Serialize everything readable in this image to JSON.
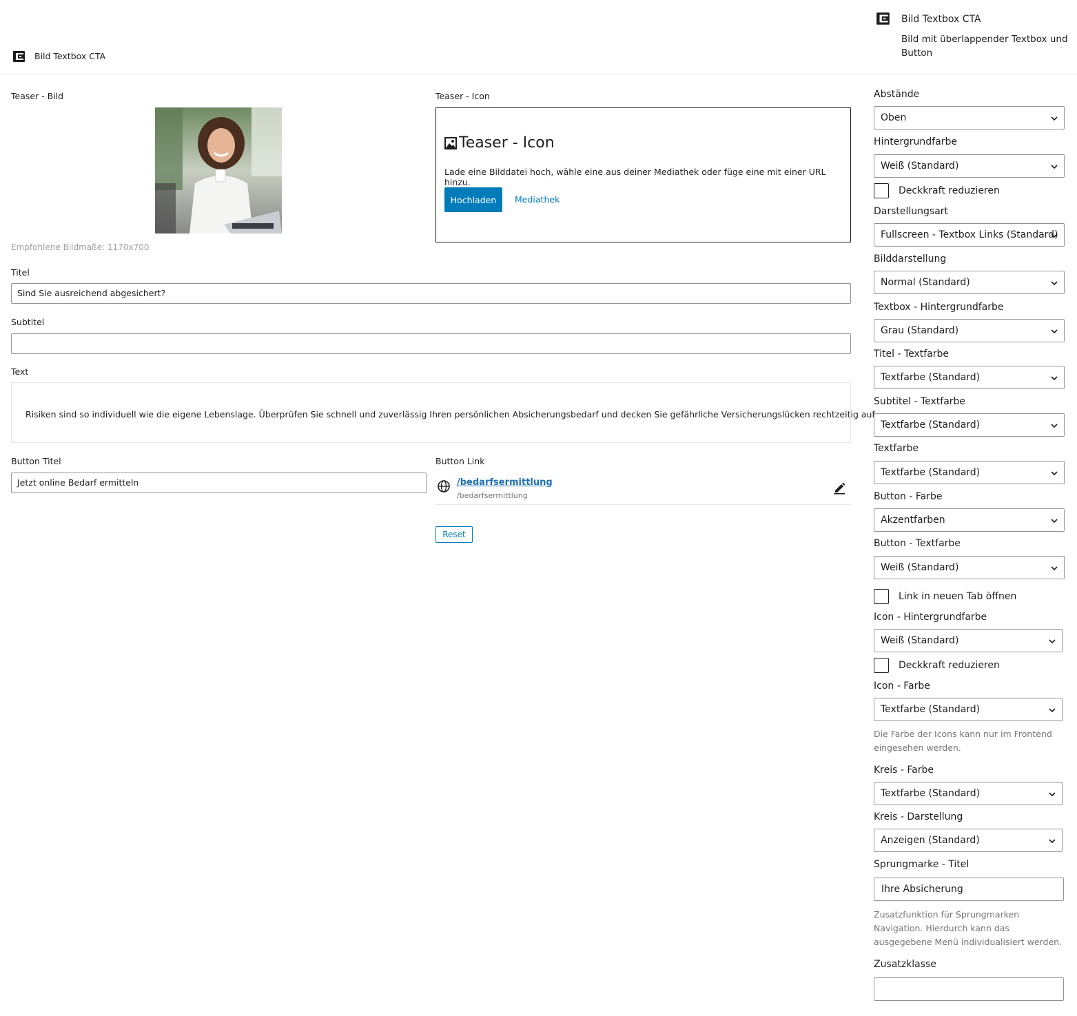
{
  "block": {
    "title": "Bild Textbox CTA",
    "description": "Bild mit überlappender Textbox und Button"
  },
  "teaser_image": {
    "label": "Teaser - Bild",
    "hint": "Empfohlene Bildmaße: 1170x700"
  },
  "teaser_icon": {
    "label": "Teaser - Icon",
    "placeholder_title": "Teaser - Icon",
    "placeholder_desc": "Lade eine Bilddatei hoch, wähle eine aus deiner Mediathek oder füge eine mit einer URL hinzu.",
    "upload_label": "Hochladen",
    "media_label": "Mediathek"
  },
  "title": {
    "label": "Titel",
    "value": "Sind Sie ausreichend abgesichert?"
  },
  "subtitle": {
    "label": "Subtitel",
    "value": ""
  },
  "text": {
    "label": "Text",
    "value": "Risiken sind so individuell wie die eigene Lebenslage. Überprüfen Sie schnell und zuverlässig Ihren persönlichen Absicherungsbedarf und decken Sie gefährliche Versicherungslücken rechtzeitig auf."
  },
  "button_title": {
    "label": "Button Titel",
    "value": "Jetzt online Bedarf ermitteln"
  },
  "button_link": {
    "label": "Button Link",
    "title": "/bedarfsermittlung",
    "url": "/bedarfsermittlung",
    "reset_label": "Reset"
  },
  "sidebar": {
    "selects": {
      "abstaende": {
        "label": "Abstände",
        "value": "Oben"
      },
      "hintergrundfarbe": {
        "label": "Hintergrundfarbe",
        "value": "Weiß (Standard)"
      },
      "darstellungsart": {
        "label": "Darstellungsart",
        "value": "Fullscreen - Textbox Links (Standard)"
      },
      "bilddarstellung": {
        "label": "Bilddarstellung",
        "value": "Normal (Standard)"
      },
      "textbox_bg": {
        "label": "Textbox - Hintergrundfarbe",
        "value": "Grau (Standard)"
      },
      "titel_textfarbe": {
        "label": "Titel - Textfarbe",
        "value": "Textfarbe (Standard)"
      },
      "subtitel_textfarbe": {
        "label": "Subtitel - Textfarbe",
        "value": "Textfarbe (Standard)"
      },
      "textfarbe": {
        "label": "Textfarbe",
        "value": "Textfarbe (Standard)"
      },
      "button_farbe": {
        "label": "Button - Farbe",
        "value": "Akzentfarben"
      },
      "button_textfarbe": {
        "label": "Button - Textfarbe",
        "value": "Weiß (Standard)"
      },
      "icon_bg": {
        "label": "Icon - Hintergrundfarbe",
        "value": "Weiß (Standard)"
      },
      "icon_farbe": {
        "label": "Icon - Farbe",
        "value": "Textfarbe (Standard)"
      },
      "kreis_farbe": {
        "label": "Kreis - Farbe",
        "value": "Textfarbe (Standard)"
      },
      "kreis_darstellung": {
        "label": "Kreis - Darstellung",
        "value": "Anzeigen (Standard)"
      }
    },
    "checks": {
      "deckkraft_1": "Deckkraft reduzieren",
      "link_new_tab": "Link in neuen Tab öffnen",
      "deckkraft_2": "Deckkraft reduzieren"
    },
    "icon_farbe_help": "Die Farbe der Icons kann nur im Frontend eingesehen werden.",
    "sprungmarke": {
      "label": "Sprungmarke - Titel",
      "value": "Ihre Absicherung",
      "help": "Zusatzfunktion für Sprungmarken Navigation. Hierdurch kann das ausgegebene Menü individualisiert werden."
    },
    "zusatzklasse": {
      "label": "Zusatzklasse",
      "value": ""
    }
  },
  "colors": {
    "primary": "#007cba",
    "link": "#1e6fb3",
    "border": "#949494",
    "help_text": "#757575"
  }
}
